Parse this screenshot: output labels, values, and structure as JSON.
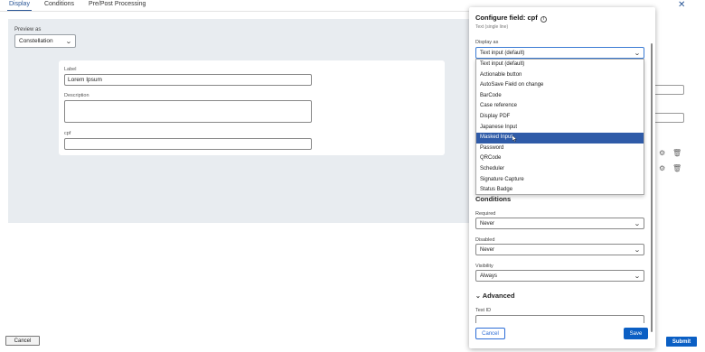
{
  "tabs": [
    {
      "label": "Display"
    },
    {
      "label": "Conditions"
    },
    {
      "label": "Pre/Post Processing"
    }
  ],
  "preview": {
    "label": "Preview as",
    "selected": "Constellation",
    "fields": {
      "label_caption": "Label",
      "label_value": "Lorem Ipsum",
      "description_caption": "Description",
      "cpf_caption": "cpf"
    }
  },
  "footer": {
    "cancel": "Cancel",
    "submit": "Submit"
  },
  "panel": {
    "title": "Configure field: cpf",
    "subtitle": "Text (single line)",
    "display_as_label": "Display as",
    "display_as_value": "Text input (default)",
    "options": [
      "Text input (default)",
      "Actionable button",
      "AutoSave Field on change",
      "BarCode",
      "Case reference",
      "Display PDF",
      "Japanese Input",
      "Masked Input",
      "Password",
      "QRCode",
      "Scheduler",
      "Signature Capture",
      "Status Badge"
    ],
    "highlighted_option": "Masked Input",
    "conditions_title": "Conditions",
    "required_label": "Required",
    "required_value": "Never",
    "disabled_label": "Disabled",
    "disabled_value": "Never",
    "visibility_label": "Visibility",
    "visibility_value": "Always",
    "advanced_title": "Advanced",
    "testid_label": "Test ID",
    "cancel": "Cancel",
    "save": "Save"
  },
  "colors": {
    "accent": "#0b5fc4",
    "highlight": "#2f5ba8",
    "canvas": "#e8ecf0"
  }
}
